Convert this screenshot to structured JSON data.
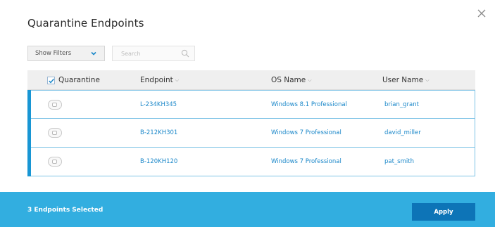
{
  "dialog": {
    "title": "Quarantine Endpoints",
    "close_icon": "close-icon"
  },
  "toolbar": {
    "filter_label": "Show Filters",
    "filter_icon": "chevron-down-icon",
    "search_placeholder": "Search",
    "search_icon": "search-icon"
  },
  "table": {
    "columns": [
      {
        "label": "Quarantine",
        "checked": true
      },
      {
        "label": "Endpoint",
        "sort_icon": "chevron-down-icon"
      },
      {
        "label": "OS Name",
        "sort_icon": "chevron-down-icon"
      },
      {
        "label": "User Name",
        "sort_icon": "chevron-down-icon"
      }
    ],
    "rows": [
      {
        "quarantine_toggle": "toggle-off",
        "endpoint": "L-234KH345",
        "os_name": "Windows 8.1 Professional",
        "user_name": "brian_grant",
        "selected": true
      },
      {
        "quarantine_toggle": "toggle-off",
        "endpoint": "B-212KH301",
        "os_name": "Windows 7 Professional",
        "user_name": "david_miller",
        "selected": true
      },
      {
        "quarantine_toggle": "toggle-off",
        "endpoint": "B-120KH120",
        "os_name": "Windows 7 Professional",
        "user_name": "pat_smith",
        "selected": true
      }
    ]
  },
  "footer": {
    "selection_text": "3 Endpoints Selected",
    "apply_label": "Apply"
  },
  "colors": {
    "accent": "#1896d4",
    "link": "#1a87c9",
    "footer_bg": "#32aee0",
    "button_bg": "#0d74b7"
  }
}
